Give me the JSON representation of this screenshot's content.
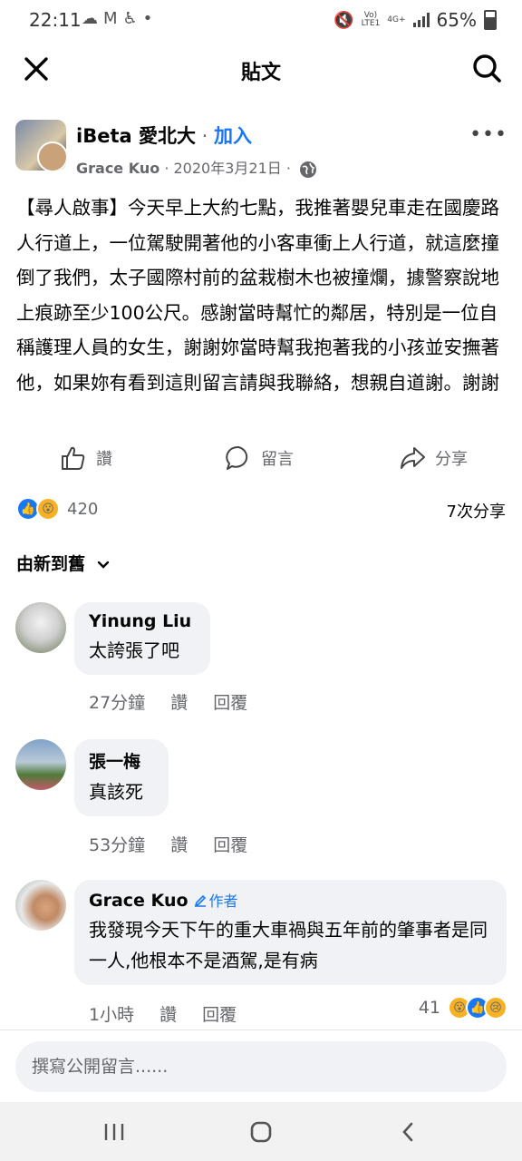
{
  "status_bar": {
    "time": "22:11",
    "left_icons": [
      "cloud-icon",
      "gmail-icon",
      "accessibility-icon",
      "dot-icon"
    ],
    "network_top": "Vo)",
    "network_bottom": "LTE1",
    "network_type": "4G+",
    "battery": "65%"
  },
  "top_bar": {
    "title": "貼文"
  },
  "post": {
    "group_name": "iBeta 愛北大",
    "separator": " · ",
    "join_label": "加入",
    "author": "Grace Kuo",
    "date": " · 2020年3月21日 · ",
    "body": "【尋人啟事】今天早上大約七點，我推著嬰兒車走在國慶路人行道上，一位駕駛開著他的小客車衝上人行道，就這麼撞倒了我們，太子國際村前的盆栽樹木也被撞爛，據警察說地上痕跡至少100公尺。感謝當時幫忙的鄰居，特別是一位自稱護理人員的女生，謝謝妳當時幫我抱著我的小孩並安撫著他，如果妳有看到這則留言請與我聯絡，想親自道謝。謝謝"
  },
  "actions": {
    "like": "讚",
    "comment": "留言",
    "share": "分享"
  },
  "reactions": {
    "count": "420",
    "shares": "7次分享"
  },
  "sort": {
    "label": "由新到舊"
  },
  "comments": [
    {
      "name": "Yinung Liu",
      "text": "太誇張了吧",
      "time": "27分鐘",
      "like": "讚",
      "reply": "回覆"
    },
    {
      "name": "張一梅",
      "text": "真該死",
      "time": "53分鐘",
      "like": "讚",
      "reply": "回覆"
    },
    {
      "name": "Grace Kuo",
      "badge": "作者",
      "text": "我發現今天下午的重大車禍與五年前的肇事者是同一人,他根本不是酒駕,是有病",
      "time": "1小時",
      "like": "讚",
      "reply": "回覆",
      "reaction_count": "41"
    }
  ],
  "compose": {
    "placeholder": "撰寫公開留言......"
  },
  "colors": {
    "accent": "#1877f2",
    "bubble": "#f0f2f5",
    "secondary_text": "#65676b"
  }
}
